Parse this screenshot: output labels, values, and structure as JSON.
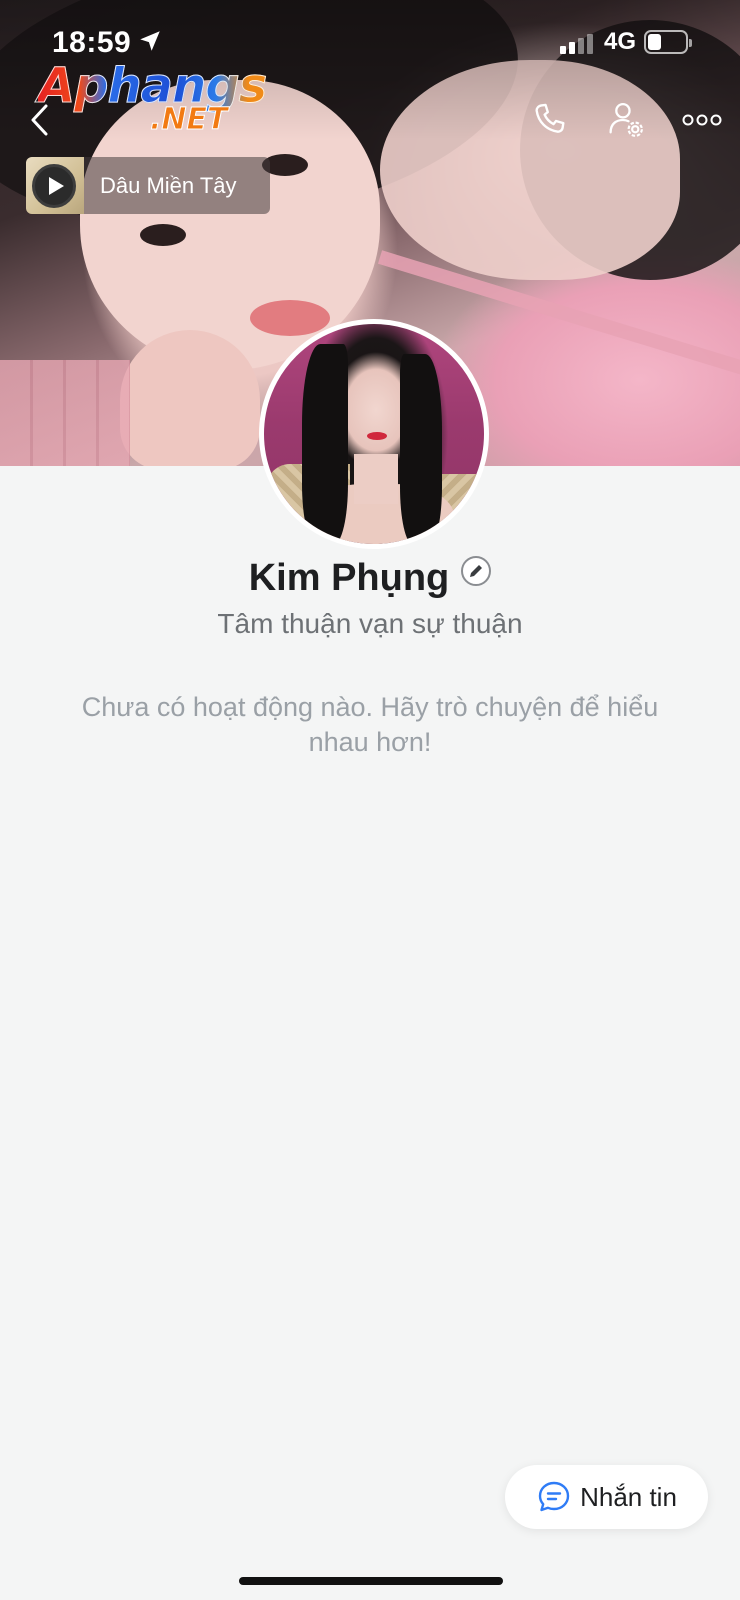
{
  "status_bar": {
    "time": "18:59",
    "network": "4G",
    "battery_level": 0.35,
    "icons": [
      "location-arrow-icon",
      "signal-icon",
      "battery-icon"
    ]
  },
  "watermark": {
    "line1": "Aphangs",
    "line2": ".NET"
  },
  "header": {
    "icons": [
      "chevron-left-icon",
      "phone-icon",
      "person-settings-icon",
      "more-icon"
    ]
  },
  "music": {
    "song_title": "Dâu Miền Tây",
    "icon": "play-icon"
  },
  "profile": {
    "name": "Kim Phụng",
    "status": "Tâm thuận vạn sự thuận",
    "empty_message": "Chưa có hoạt động nào. Hãy trò chuyện để hiểu nhau hơn!"
  },
  "actions": {
    "message_label": "Nhắn tin",
    "message_icon": "chat-bubble-icon"
  },
  "colors": {
    "background": "#f4f5f5",
    "accent": "#2f7cf6",
    "name_text": "#1e1f21",
    "secondary_text": "#6d7175",
    "muted_text": "#9aa0a6"
  }
}
